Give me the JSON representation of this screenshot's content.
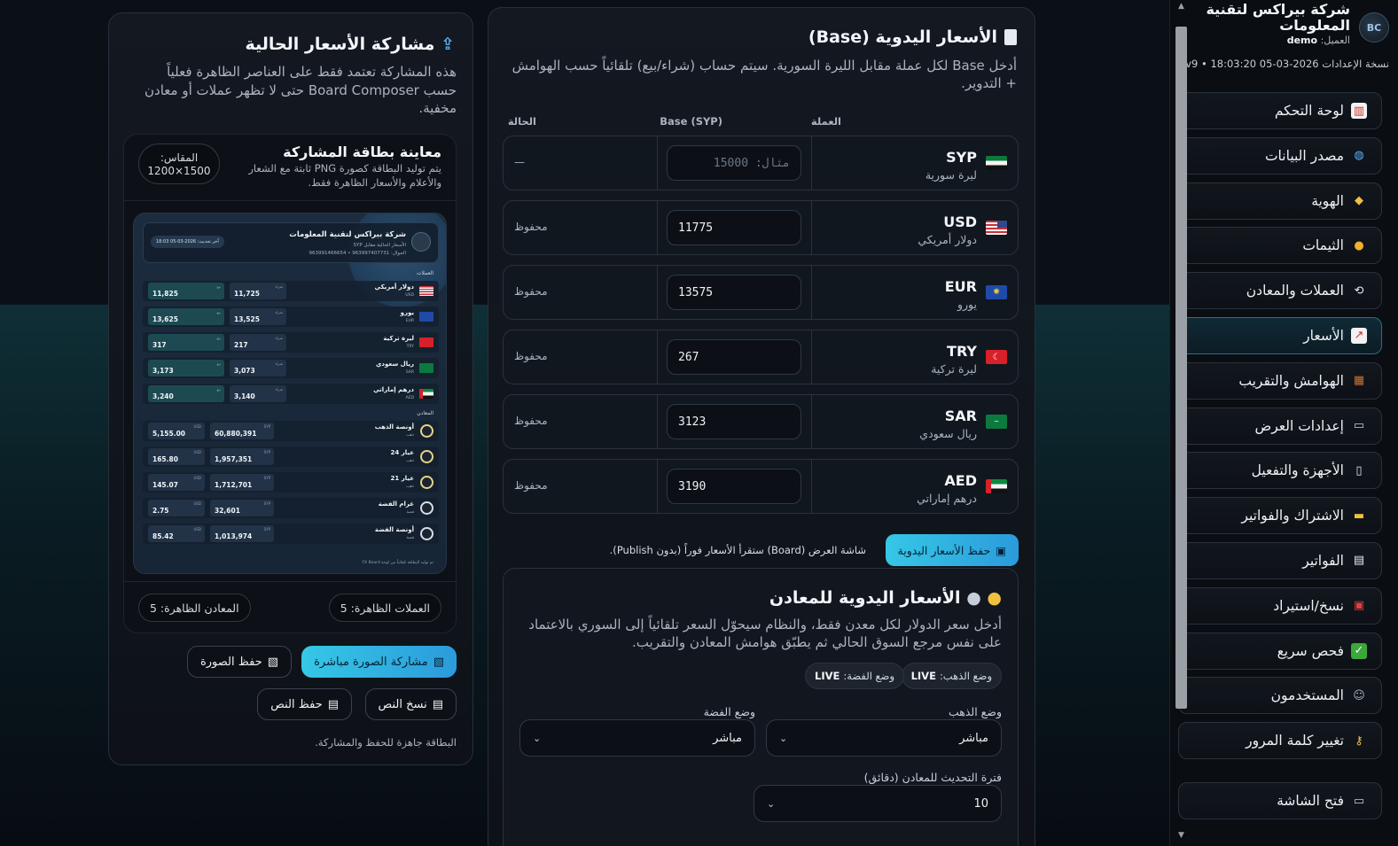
{
  "sidebar": {
    "company": "شركة بيراكس لتقنية المعلومات",
    "user_label": "العميل:",
    "user_value": "demo",
    "version": "نسخة الإعدادات 2026-03-05 18:03:20 • v9",
    "logo_text": "BC",
    "items": [
      {
        "label": "لوحة التحكم",
        "icon": "bar-chart-icon"
      },
      {
        "label": "مصدر البيانات",
        "icon": "globe-icon"
      },
      {
        "label": "الهوية",
        "icon": "tag-icon"
      },
      {
        "label": "الثيمات",
        "icon": "palette-icon"
      },
      {
        "label": "العملات والمعادن",
        "icon": "exchange-icon"
      },
      {
        "label": "الأسعار",
        "icon": "trend-chart-icon"
      },
      {
        "label": "الهوامش والتقريب",
        "icon": "abacus-icon"
      },
      {
        "label": "إعدادات العرض",
        "icon": "monitor-icon"
      },
      {
        "label": "الأجهزة والتفعيل",
        "icon": "device-icon"
      },
      {
        "label": "الاشتراك والفواتير",
        "icon": "credit-card-icon"
      },
      {
        "label": "الفواتير",
        "icon": "page-icon"
      },
      {
        "label": "نسخ/استيراد",
        "icon": "toolbox-icon"
      },
      {
        "label": "فحص سريع",
        "icon": "check-icon"
      },
      {
        "label": "المستخدمون",
        "icon": "users-icon"
      },
      {
        "label": "تغيير كلمة المرور",
        "icon": "key-icon"
      }
    ],
    "active_index": 5,
    "extra_item": {
      "label": "فتح الشاشة",
      "icon": "monitor-icon"
    }
  },
  "prices": {
    "title": "الأسعار اليدوية (Base)",
    "description": "أدخل Base لكل عملة مقابل الليرة السورية. سيتم حساب (شراء/بيع) تلقائياً حسب الهوامش + التدوير.",
    "col_currency": "العملة",
    "col_base": "Base (SYP)",
    "col_status": "الحالة",
    "rows": [
      {
        "code": "SYP",
        "name": "ليرة سورية",
        "value": "",
        "placeholder": "مثال: 15000",
        "status": "—"
      },
      {
        "code": "USD",
        "name": "دولار أمريكي",
        "value": "11775",
        "placeholder": "",
        "status": "محفوظ"
      },
      {
        "code": "EUR",
        "name": "يورو",
        "value": "13575",
        "placeholder": "",
        "status": "محفوظ"
      },
      {
        "code": "TRY",
        "name": "ليرة تركية",
        "value": "267",
        "placeholder": "",
        "status": "محفوظ"
      },
      {
        "code": "SAR",
        "name": "ريال سعودي",
        "value": "3123",
        "placeholder": "",
        "status": "محفوظ"
      },
      {
        "code": "AED",
        "name": "درهم إماراتي",
        "value": "3190",
        "placeholder": "",
        "status": "محفوظ"
      }
    ],
    "save_button": "حفظ الأسعار اليدوية",
    "save_hint": "شاشة العرض (Board) ستقرأ الأسعار فوراً (بدون Publish)."
  },
  "metals": {
    "title": "الأسعار اليدوية للمعادن",
    "description": "أدخل سعر الدولار لكل معدن فقط، والنظام سيحوّل السعر تلقائياً إلى السوري بالاعتماد على نفس مرجع السوق الحالي ثم يطبّق هوامش المعادن والتقريب.",
    "gold_mode_label": "وضع الذهب:",
    "gold_mode_value": "LIVE",
    "silver_mode_label": "وضع الفضة:",
    "silver_mode_value": "LIVE",
    "gold_select_label": "وضع الذهب",
    "gold_select_value": "مباشر",
    "silver_select_label": "وضع الفضة",
    "silver_select_value": "مباشر",
    "interval_label": "فترة التحديث للمعادن (دقائق)",
    "interval_value": "10"
  },
  "share": {
    "title": "مشاركة الأسعار الحالية",
    "description": "هذه المشاركة تعتمد فقط على العناصر الظاهرة فعلياً حسب Board Composer حتى لا تظهر عملات أو معادن مخفية.",
    "preview_title": "معاينة بطاقة المشاركة",
    "preview_desc": "يتم توليد البطاقة كصورة PNG ثابتة مع الشعار والأعلام والأسعار الظاهرة فقط.",
    "scale_label": "المقاس:",
    "scale_value": "1500×1200",
    "currencies_count": "العملات الظاهرة: 5",
    "metals_count": "المعادن الظاهرة: 5",
    "btn_share_image": "مشاركة الصورة مباشرة",
    "btn_save_image": "حفظ الصورة",
    "btn_copy_text": "نسخ النص",
    "btn_save_text": "حفظ النص",
    "status": "البطاقة جاهزة للحفظ والمشاركة."
  },
  "mini_card": {
    "company": "شركة بيراكس لتقنية المعلومات",
    "subtitle": "الأسعار الحالية مقابل SYP",
    "phone": "الجوال: 963997407731 • 963991466654",
    "date": "آخر تحديث: 2026-03-05 18:03",
    "currencies_label": "العملات",
    "metals_label": "المعادن",
    "buy_label": "شراء",
    "sell_label": "بيع",
    "syp_label": "SYP",
    "usd_label": "USD",
    "currencies": [
      {
        "name": "دولار أمريكي",
        "code": "USD",
        "buy": "11,725",
        "sell": "11,825"
      },
      {
        "name": "يورو",
        "code": "EUR",
        "buy": "13,525",
        "sell": "13,625"
      },
      {
        "name": "ليرة تركية",
        "code": "TRY",
        "buy": "217",
        "sell": "317"
      },
      {
        "name": "ريال سعودي",
        "code": "SAR",
        "buy": "3,073",
        "sell": "3,173"
      },
      {
        "name": "درهم إماراتي",
        "code": "AED",
        "buy": "3,140",
        "sell": "3,240"
      }
    ],
    "metals": [
      {
        "name": "أونصة الذهب",
        "kind": "ذهب",
        "syp": "60,880,391",
        "usd": "5,155.00"
      },
      {
        "name": "عيار 24",
        "kind": "ذهب",
        "syp": "1,957,351",
        "usd": "165.80"
      },
      {
        "name": "عيار 21",
        "kind": "ذهب",
        "syp": "1,712,701",
        "usd": "145.07"
      },
      {
        "name": "غرام الفضة",
        "kind": "فضة",
        "syp": "32,601",
        "usd": "2.75"
      },
      {
        "name": "أونصة الفضة",
        "kind": "فضة",
        "syp": "1,013,974",
        "usd": "85.42"
      }
    ],
    "footer": "تم توليد البطاقة تلقائياً من لوحة FX Board"
  },
  "colors": {
    "accent": "#36c7e6",
    "panel": "#141921",
    "border": "#2a323d"
  }
}
